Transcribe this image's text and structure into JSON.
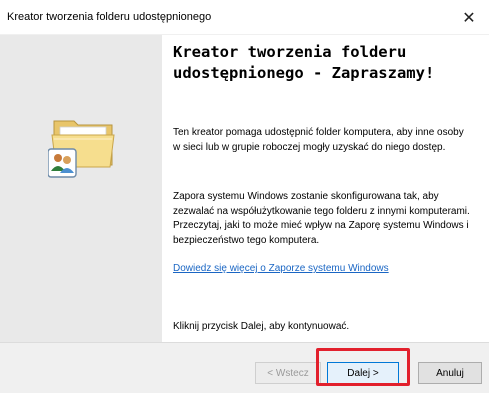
{
  "window": {
    "title": "Kreator tworzenia folderu udostępnionego",
    "close_glyph": "✕"
  },
  "content": {
    "heading_line1": "Kreator tworzenia folderu",
    "heading_line2": "udostępnionego - Zapraszamy!",
    "paragraph1": "Ten kreator pomaga udostępnić folder komputera, aby inne osoby w sieci lub w grupie roboczej mogły uzyskać do niego dostęp.",
    "paragraph2": "Zapora systemu Windows zostanie skonfigurowana tak, aby zezwalać na współużytkowanie tego folderu z innymi komputerami. Przeczytaj, jaki to może mieć wpływ na Zaporę systemu Windows i bezpieczeństwo tego komputera.",
    "link": "Dowiedz się więcej o Zaporze systemu Windows",
    "continue_hint": "Kliknij przycisk Dalej, aby kontynuować."
  },
  "buttons": {
    "back": "< Wstecz",
    "next": "Dalej >",
    "cancel": "Anuluj"
  },
  "colors": {
    "link": "#1a66c4",
    "highlight": "#e2202c",
    "left_panel": "#e9e9e9"
  },
  "icons": {
    "wizard_art": "shared-folder-icon",
    "users_badge": "users-icon"
  }
}
